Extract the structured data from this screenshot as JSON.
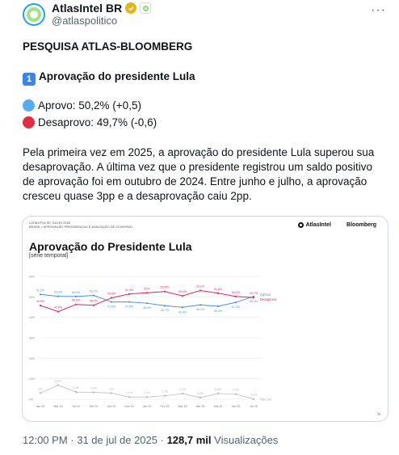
{
  "tweet": {
    "author_name": "AtlasIntel BR",
    "handle": "@atlaspolitico",
    "more_label": "···",
    "headline": "PESQUISA ATLAS-BLOOMBERG",
    "topic_badge": "1",
    "topic": "Aprovação do presidente Lula",
    "approve_line": "Aprovo: 50,2% (+0,5)",
    "disapprove_line": "Desaprovo: 49,7% (-0,6)",
    "body_lines": [
      "Pela primeira vez em 2025, a aprovação do presidente Lula superou sua",
      "desaprovação. A última vez que o presidente registrou um saldo positivo",
      "de aprovação foi em outubro de 2024. Entre junho e julho, a aprovação",
      "cresceu quase 3pp e a desaprovação caiu 2pp."
    ],
    "time": "12:00 PM",
    "date": "31 de jul de 2025",
    "views_count": "128,7 mil",
    "views_label": "Visualizações"
  },
  "colors": {
    "approve": "#4a90d9",
    "disapprove": "#e0245e",
    "dont_know": "#b5b5b5"
  },
  "card": {
    "meta1": "LATAM PULSE JULHO 2025",
    "meta2": "BRASIL • APROVAÇÃO PRESIDENCIAL E AVALIAÇÃO DE GOVERNO",
    "brand1": "AtlasIntel",
    "brand2": "Bloomberg"
  },
  "chart_data": {
    "type": "line",
    "title": "Aprovação do Presidente Lula",
    "subtitle": "[série temporal]",
    "x": [
      "Jan 24",
      "Mar 24",
      "Jul 24",
      "Set 24",
      "Out 24",
      "Dez 24",
      "Jan 25",
      "Fev 25",
      "Mar 25",
      "Abr 25",
      "Mai 25",
      "Jun 25",
      "Jul 25"
    ],
    "series": [
      {
        "name": "Aprovo",
        "values": [
          51.2,
          50.3,
          50.2,
          50.7,
          47.5,
          47.5,
          46.9,
          45.7,
          44.9,
          46.1,
          45.4,
          47.3,
          50.2
        ]
      },
      {
        "name": "Desaprovo",
        "values": [
          45.8,
          42.8,
          46.3,
          45.9,
          49.5,
          51.4,
          52.0,
          52.6,
          50.5,
          53.1,
          51.8,
          50.2,
          49.7
        ]
      },
      {
        "name": "Não sei",
        "values": [
          3.0,
          6.9,
          3.5,
          3.4,
          3.0,
          1.1,
          1.1,
          1.7,
          2.7,
          0.8,
          2.8,
          2.5,
          0.1
        ]
      }
    ],
    "point_labels": {
      "Aprovo": [
        "51,2%",
        "50,3%",
        "50,2%",
        "50,7%",
        "47,5%",
        "47,5%",
        "46,9%",
        "45,7%",
        "44,9%",
        "46,1%",
        "45,4%",
        "47,3%",
        "50,2%"
      ],
      "Desaprovo": [
        "45,8%",
        "42,8%",
        "46,3%",
        "45,9%",
        "49,5%",
        "51,4%",
        "52%",
        "52,6%",
        "50,5%",
        "53,1%",
        "51,8%",
        "50,2%",
        "49,7%"
      ],
      "Não sei": [
        "3%",
        "6,9%",
        "3,5%",
        "3,4%",
        "3%",
        "1,1%",
        "1,1%",
        "1,7%",
        "2,7%",
        "0,8%",
        "2,8%",
        "2,5%",
        "0,1%"
      ]
    },
    "ylim": [
      0,
      60
    ],
    "yticks": [
      "60%",
      "50%",
      "40%",
      "30%",
      "20%",
      "10%",
      "0%"
    ],
    "legend": [
      "Aprovo",
      "Desaprovo",
      "Não sei"
    ],
    "grid": true
  }
}
